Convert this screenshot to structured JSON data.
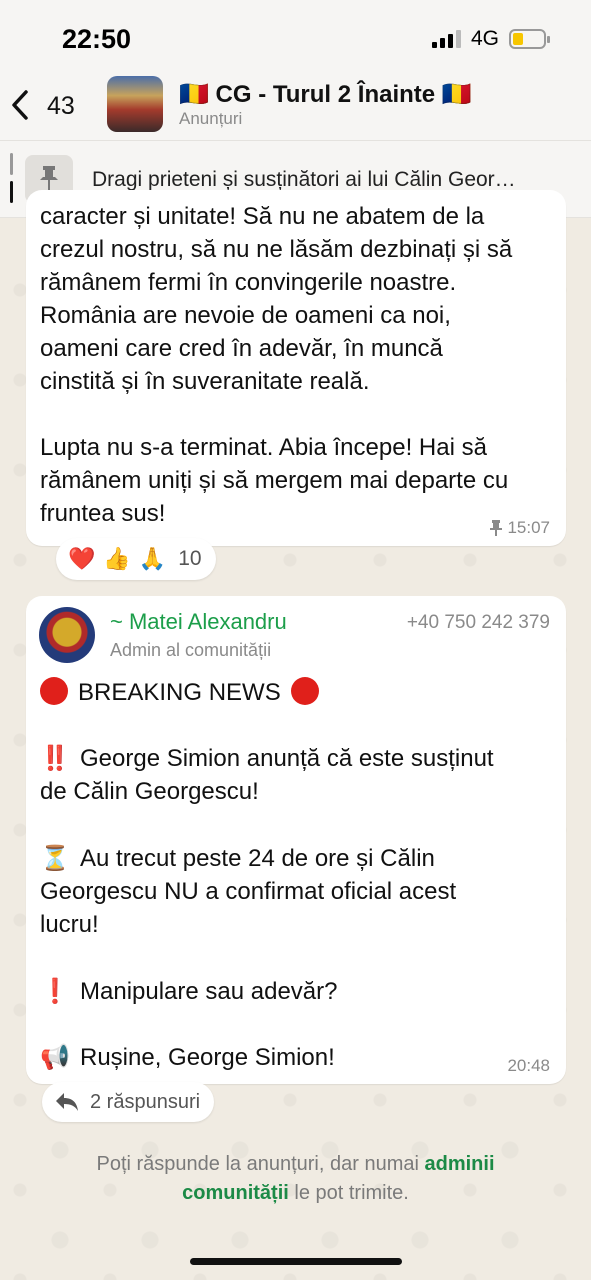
{
  "status_bar": {
    "time": "22:50",
    "network": "4G",
    "battery_level": 0.3
  },
  "header": {
    "back_count": "43",
    "title": "🇷🇴 CG - Turul 2 Înainte 🇷🇴",
    "subtitle": "Anunțuri"
  },
  "pinned": {
    "text": "Dragi prieteni și susținători ai lui Călin Geor…",
    "icon": "pin-icon"
  },
  "message1": {
    "text": "caracter și unitate! Să nu ne abatem de la\ncrezul nostru, să nu ne lăsăm dezbinați și să\nrămânem fermi în convingerile noastre.\nRomânia are nevoie de oameni ca noi,\noameni care cred în adevăr, în muncă\ncinstită și în suveranitate reală.\n\nLupta nu s-a terminat. Abia începe! Hai să\nrămânem uniți și să mergem mai departe cu\nfruntea sus!",
    "time": "15:07",
    "reactions": {
      "emoji": [
        "❤️",
        "👍",
        "🙏"
      ],
      "count": "10"
    }
  },
  "message2": {
    "sender_name": "~ Matei Alexandru",
    "sender_phone": "+40 750 242 379",
    "sender_role": "Admin al comunității",
    "line1": "BREAKING NEWS",
    "line2": "George Simion anunță că este susținut",
    "line3": "de Călin Georgescu!",
    "line4": "Au trecut peste 24 de ore și Călin",
    "line5": "Georgescu NU a confirmat oficial acest",
    "line6": "lucru!",
    "line7": "Manipulare sau adevăr?",
    "line8": "Rușine, George Simion!",
    "emoji_double_exclaim": "‼️",
    "emoji_hourglass": "⏳",
    "emoji_exclaim": "❗",
    "emoji_megaphone": "📢",
    "time": "20:48",
    "replies": "2 răspunsuri"
  },
  "footer": {
    "part1": "Poți răspunde la anunțuri, dar numai ",
    "highlight1": "adminii",
    "highlight2": "comunității",
    "part2": " le pot trimite."
  },
  "colors": {
    "accent_green": "#1c9e4a",
    "bubble": "#ffffff",
    "chat_bg": "#efeae2"
  }
}
